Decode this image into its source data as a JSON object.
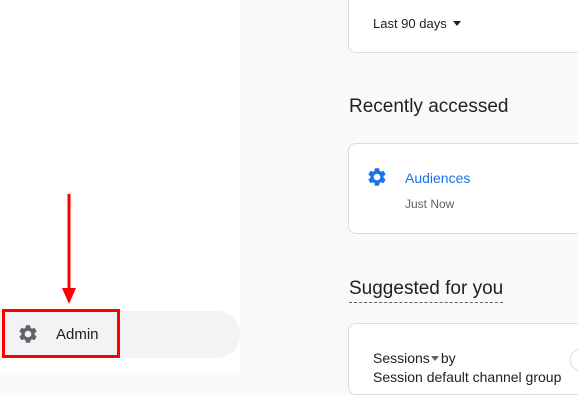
{
  "sidebar": {
    "admin_label": "Admin",
    "admin_icon": "gear-icon"
  },
  "date_range": {
    "label": "Last 90 days"
  },
  "recently_accessed": {
    "title": "Recently accessed",
    "items": [
      {
        "label": "Audiences",
        "time": "Just Now",
        "icon": "gear-icon"
      }
    ]
  },
  "suggested": {
    "title": "Suggested for you",
    "card_title_prefix": "Sessions",
    "card_title_suffix": "by",
    "card_subtitle_partial": "Session default channel group"
  },
  "colors": {
    "link": "#1a73e8",
    "annotation": "#ff0000",
    "sidebar_bg": "#ffffff",
    "main_bg": "#f8f9fa"
  }
}
